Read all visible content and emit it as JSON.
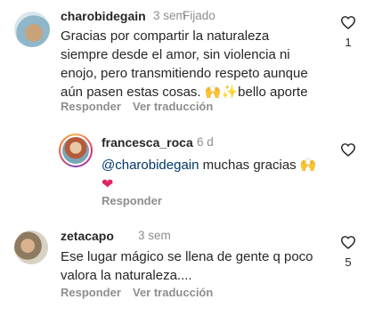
{
  "comments": [
    {
      "username": "charobidegain",
      "time": "3 sem",
      "pinned": "Fijado",
      "text": "Gracias por compartir la naturaleza siempre desde el amor, sin violencia ni enojo, pero transmitiendo respeto aunque aún pasen estas cosas. 🙌✨bello aporte",
      "lines": [
        "Gracias por compartir la naturaleza",
        "siempre desde el amor, sin violencia ni",
        "enojo, pero transmitiendo respeto aunque",
        "aún pasen estas cosas. "
      ],
      "line4_tail": "bello aporte",
      "emojis": "🙌✨",
      "reply_label": "Responder",
      "translate_label": "Ver traducción",
      "likes": "1"
    },
    {
      "username": "francesca_roca",
      "time": "6 d",
      "mention": "@charobidegain",
      "text_rest": " muchas gracias ",
      "emojis": "🙌",
      "heart_emoji": "❤",
      "reply_label": "Responder"
    },
    {
      "username": "zetacapo",
      "time": "3 sem",
      "lines": [
        "Ese lugar mágico se llena de gente q poco",
        "valora la naturaleza...."
      ],
      "reply_label": "Responder",
      "translate_label": "Ver traducción",
      "likes": "5"
    }
  ],
  "colors": {
    "text": "#262626",
    "muted": "#8e8e8e",
    "mention": "#00376b",
    "heart_red": "#e0245e"
  },
  "icons": [
    "avatar",
    "heart-outline-icon",
    "like-count"
  ]
}
